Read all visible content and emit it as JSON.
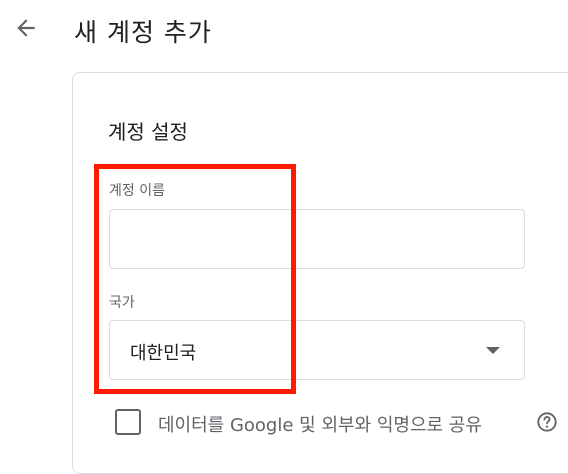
{
  "header": {
    "title": "새 계정 추가",
    "back_icon": "arrow-left-icon"
  },
  "account_settings": {
    "section_title": "계정 설정",
    "account_name": {
      "label": "계정 이름",
      "value": "",
      "placeholder": ""
    },
    "country": {
      "label": "국가",
      "selected": "대한민국"
    },
    "share_data": {
      "label": "데이터를 Google 및 외부와 익명으로 공유",
      "checked": false,
      "help_icon": "help-circle-icon"
    }
  },
  "colors": {
    "highlight": "#ff1a00",
    "border": "#dadce0",
    "text_primary": "#202124",
    "text_secondary": "#5f6368"
  }
}
